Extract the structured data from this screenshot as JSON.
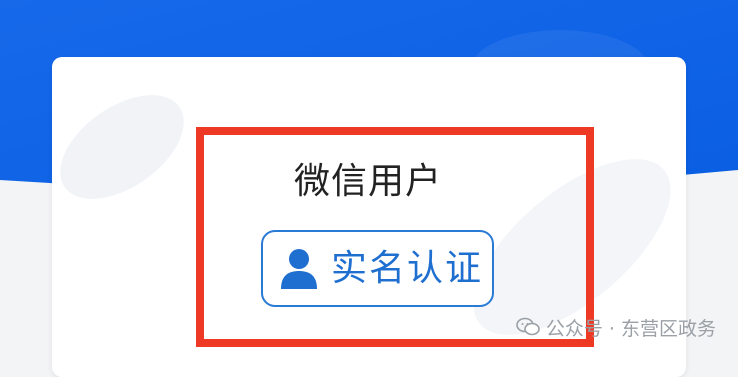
{
  "profile": {
    "user_name": "微信用户",
    "verify_button_label": "实名认证"
  },
  "watermark": {
    "text": "公众号 · 东营区政务"
  },
  "colors": {
    "header_blue": "#0d63e6",
    "highlight_red": "#ee3a24",
    "button_blue": "#1f6fd0",
    "card_bg": "#ffffff",
    "page_bg": "#f3f4f6"
  },
  "icons": {
    "verify_button_icon": "user-icon",
    "watermark_icon": "wechat-icon"
  }
}
